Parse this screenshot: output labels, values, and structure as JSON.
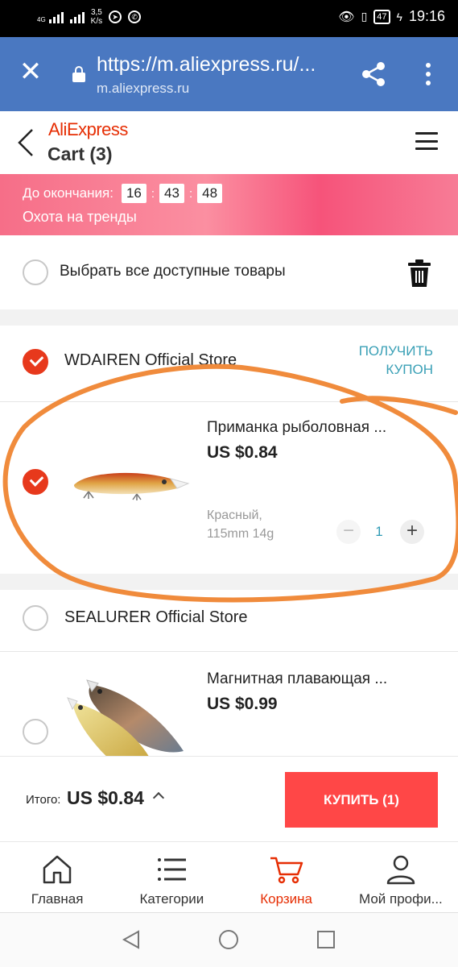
{
  "status_bar": {
    "net_type": "4G",
    "speed_value": "3,5",
    "speed_unit": "K/s",
    "battery": "47",
    "time": "19:16"
  },
  "browser": {
    "url": "https://m.aliexpress.ru/...",
    "host": "m.aliexpress.ru"
  },
  "header": {
    "brand": "AliExpress",
    "title": "Cart (3)"
  },
  "promo": {
    "countdown_label": "До окончания:",
    "hours": "16",
    "minutes": "43",
    "seconds": "48",
    "separator": ":",
    "subtitle": "Охота на тренды"
  },
  "select_all": {
    "label": "Выбрать все доступные товары",
    "checked": false
  },
  "stores": [
    {
      "name": "WDAIREN Official Store",
      "checked": true,
      "coupon_line1": "ПОЛУЧИТЬ",
      "coupon_line2": "КУПОН",
      "item": {
        "title": "Приманка рыболовная ...",
        "price": "US $0.84",
        "variant_line1": "Красный,",
        "variant_line2": "115mm 14g",
        "quantity": "1",
        "checked": true
      }
    },
    {
      "name": "SEALURER Official Store",
      "checked": false,
      "item": {
        "title": "Магнитная плавающая ...",
        "price": "US $0.99",
        "checked": false
      }
    }
  ],
  "checkout": {
    "total_label": "Итого:",
    "total_value": "US $0.84",
    "buy_label": "КУПИТЬ (1)"
  },
  "tabs": [
    {
      "label": "Главная",
      "icon": "home-icon",
      "active": false
    },
    {
      "label": "Категории",
      "icon": "categories-icon",
      "active": false
    },
    {
      "label": "Корзина",
      "icon": "cart-icon",
      "active": true
    },
    {
      "label": "Мой профи...",
      "icon": "profile-icon",
      "active": false
    }
  ],
  "colors": {
    "brand": "#e62e04",
    "browser_bar": "#4a78c1",
    "buy_button": "#ff4747",
    "coupon_link": "#3aa0b6",
    "annotation": "#f08b3c"
  }
}
